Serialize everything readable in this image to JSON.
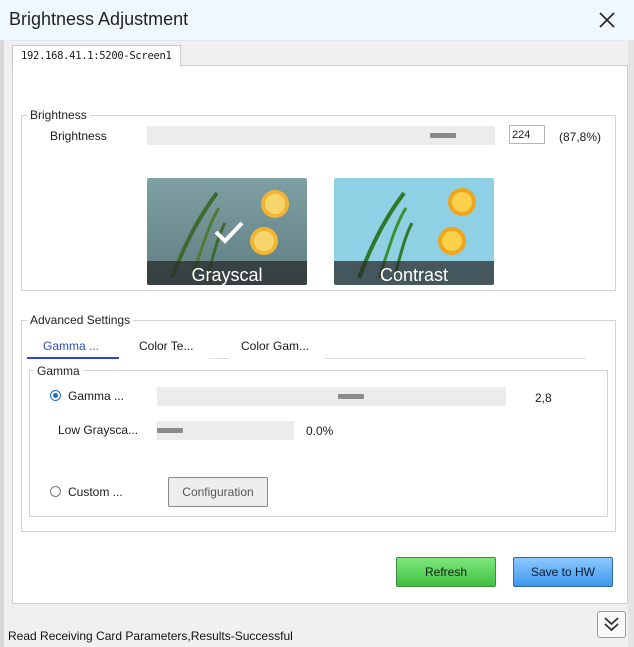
{
  "window": {
    "title": "Brightness Adjustment",
    "close_icon": "close-icon",
    "tab": "192.168.41.1:5200-Screen1"
  },
  "brightness": {
    "group_label": "Brightness",
    "label": "Brightness",
    "value": "224",
    "percent": "(87,8%)",
    "slider_fraction": 0.878
  },
  "presets": [
    {
      "label": "Grayscal",
      "selected": true
    },
    {
      "label": "Contrast",
      "selected": false
    }
  ],
  "advanced": {
    "group_label": "Advanced Settings",
    "tabs": [
      "Gamma ...",
      "Color Te...",
      "Color Gam..."
    ],
    "active_tab": 0,
    "gamma": {
      "group_label": "Gamma",
      "gamma_option": "Gamma ...",
      "gamma_value": "2,8",
      "gamma_fraction": 0.56,
      "low_gray_label": "Low Graysca...",
      "low_gray_value": "0.0%",
      "low_gray_fraction": 0.0,
      "custom_option": "Custom ...",
      "config_button": "Configuration"
    }
  },
  "buttons": {
    "refresh": "Refresh",
    "save": "Save to HW"
  },
  "status": "Read Receiving Card Parameters,Results-Successful",
  "colors": {
    "refresh_green": "#4fcf4f",
    "save_blue": "#4aa0f0",
    "active_tab": "#2b4acb"
  }
}
